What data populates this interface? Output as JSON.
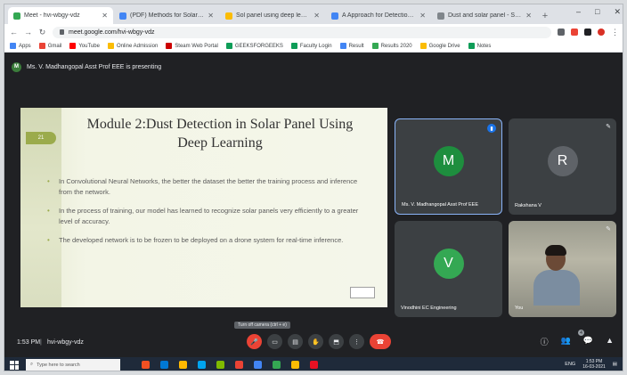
{
  "browser": {
    "tabs": [
      {
        "title": "Meet - hvi-wbgy-vdz",
        "favicon": "#34a853",
        "active": true
      },
      {
        "title": "(PDF) Methods for Solar panel d...",
        "favicon": "#4285f4",
        "active": false
      },
      {
        "title": "Sol panel using deep learning",
        "favicon": "#fbbc04",
        "active": false
      },
      {
        "title": "A Approach for Detection of...",
        "favicon": "#4285f4",
        "active": false
      },
      {
        "title": "Dust and solar panel - Scih...",
        "favicon": "#80868b",
        "active": false
      }
    ],
    "new_tab": "+",
    "window_controls": [
      "–",
      "□",
      "✕"
    ],
    "url": "meet.google.com/hvi-wbgy-vdz",
    "bookmarks": [
      {
        "label": "Apps",
        "color": "#4285f4"
      },
      {
        "label": "Gmail",
        "color": "#ea4335"
      },
      {
        "label": "YouTube",
        "color": "#ff0000"
      },
      {
        "label": "Online Admission",
        "color": "#fbbc04"
      },
      {
        "label": "Steam Web Portal",
        "color": "#cc0000"
      },
      {
        "label": "GEEKSFORGEEKS",
        "color": "#0f9d58"
      },
      {
        "label": "Faculty Login",
        "color": "#0f9d58"
      },
      {
        "label": "Result",
        "color": "#4285f4"
      },
      {
        "label": "Results 2020",
        "color": "#34a853"
      },
      {
        "label": "Google Drive",
        "color": "#fbbc04"
      },
      {
        "label": "Notes",
        "color": "#0f9d58"
      }
    ]
  },
  "meet": {
    "presenter_initial": "M",
    "presenting_text": "Ms. V. Madhangopal Asst Prof EEE is presenting",
    "slide": {
      "badge": "21",
      "title": "Module 2:Dust Detection in Solar Panel Using Deep Learning",
      "bullets": [
        "In Convolutional Neural Networks, the better the dataset the better the training process and inference from the network.",
        "In the process of training, our model has learned to recognize solar panels very efficiently to a greater level of accuracy.",
        "The developed network is to be frozen to be deployed on a drone system for real-time inference."
      ]
    },
    "tiles": [
      {
        "initial": "M",
        "color": "#1e8e3e",
        "name": "Ms. V. Madhangopal Asst Prof EEE",
        "icon": "🔊"
      },
      {
        "initial": "R",
        "color": "#5f6368",
        "name": "Rakshana V",
        "icon": "✎"
      },
      {
        "initial": "V",
        "color": "#34a853",
        "name": "Vinodhini EC Engineering",
        "icon": ""
      },
      {
        "initial": "",
        "color": "",
        "name": "You",
        "icon": "✎"
      }
    ],
    "bottom": {
      "time": "1:53 PM",
      "separator": "|",
      "meeting_code": "hvi-wbgy-vdz",
      "tooltip": "Turn off camera (ctrl + e)",
      "controls": [
        "🎤",
        "▭",
        "▤",
        "✋",
        "⬒",
        "⋮",
        "☎"
      ],
      "right": [
        "ⓘ",
        "👥",
        "💬",
        "▲"
      ],
      "participant_count": "4"
    }
  },
  "taskbar": {
    "search_placeholder": "Type here to search",
    "apps": [
      "#f25022",
      "#0078d4",
      "#ffb900",
      "#00a4ef",
      "#7fba00",
      "#ea4335",
      "#4285f4",
      "#34a853",
      "#fbbc04",
      "#e81123"
    ],
    "time": "1:53 PM",
    "date": "16-03-2021",
    "language": "ENG"
  }
}
